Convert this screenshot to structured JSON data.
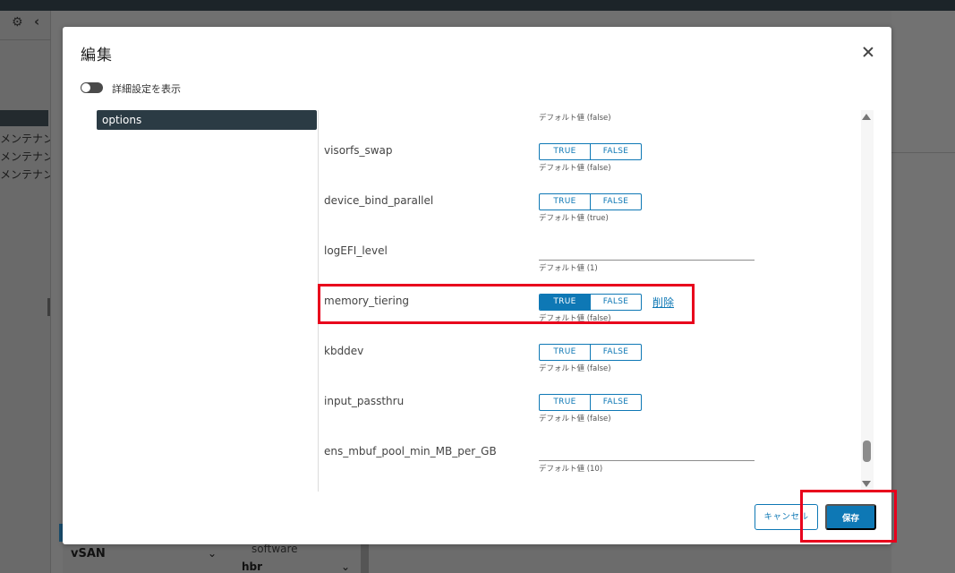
{
  "background": {
    "maintenance_rows": [
      "メンテナンス",
      "メンテナンス",
      "メンテナンス"
    ],
    "bottom": {
      "vsan_label": "vSAN",
      "software_label": "software",
      "hbr_label": "hbr"
    }
  },
  "modal": {
    "title": "編集",
    "advanced_toggle_label": "詳細設定を表示",
    "nav": {
      "selected": "options"
    },
    "top_default": "デフォルト値 (false)",
    "properties": [
      {
        "name": "visorfs_swap",
        "type": "boolean",
        "true_label": "TRUE",
        "false_label": "FALSE",
        "default": "デフォルト値 (false)",
        "selected": "none"
      },
      {
        "name": "device_bind_parallel",
        "type": "boolean",
        "true_label": "TRUE",
        "false_label": "FALSE",
        "default": "デフォルト値 (true)",
        "selected": "none"
      },
      {
        "name": "logEFI_level",
        "type": "text",
        "value": "",
        "default": "デフォルト値 (1)"
      },
      {
        "name": "memory_tiering",
        "type": "boolean",
        "true_label": "TRUE",
        "false_label": "FALSE",
        "default": "デフォルト値 (false)",
        "selected": "TRUE",
        "delete_label": "削除"
      },
      {
        "name": "kbddev",
        "type": "boolean",
        "true_label": "TRUE",
        "false_label": "FALSE",
        "default": "デフォルト値 (false)",
        "selected": "none"
      },
      {
        "name": "input_passthru",
        "type": "boolean",
        "true_label": "TRUE",
        "false_label": "FALSE",
        "default": "デフォルト値 (false)",
        "selected": "none"
      },
      {
        "name": "ens_mbuf_pool_min_MB_per_GB",
        "type": "text",
        "value": "",
        "default": "デフォルト値 (10)"
      }
    ],
    "footer": {
      "cancel_label": "キャンセル",
      "save_label": "保存"
    }
  },
  "colors": {
    "accent": "#0e78b5",
    "highlight": "#e8001c",
    "nav_selected_bg": "#2b3b44"
  }
}
